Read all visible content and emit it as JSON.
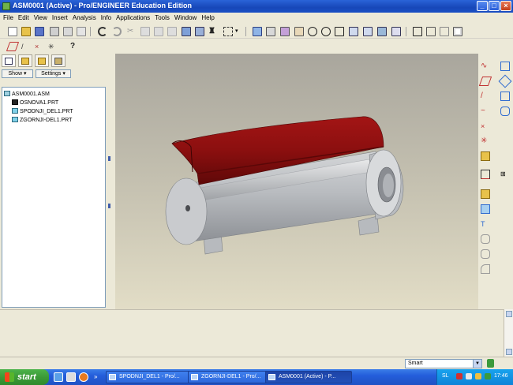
{
  "window": {
    "title": "ASM0001 (Active) - Pro/ENGINEER Education Edition",
    "minimize": "_",
    "maximize": "□",
    "close": "×"
  },
  "menu": [
    "File",
    "Edit",
    "View",
    "Insert",
    "Analysis",
    "Info",
    "Applications",
    "Tools",
    "Window",
    "Help"
  ],
  "left_panel": {
    "show_button": "Show ▾",
    "settings_button": "Settings ▾",
    "tree": [
      {
        "label": "ASM0001.ASM",
        "icon": "assembly-icon"
      },
      {
        "label": "OSNOVA1.PRT",
        "icon": "part-icon"
      },
      {
        "label": "SPODNJI_DEL1.PRT",
        "icon": "part-icon"
      },
      {
        "label": "ZGORNJI-DEL1.PRT",
        "icon": "part-icon"
      }
    ]
  },
  "status": {
    "filter_value": "Smart"
  },
  "taskbar": {
    "start": "start",
    "tasks": [
      {
        "label": "SPODNJI_DEL1 - Pro/...",
        "active": false
      },
      {
        "label": "ZGORNJI-DEL1 - Pro/...",
        "active": false
      },
      {
        "label": "ASM0001 (Active) - P...",
        "active": true
      }
    ],
    "language": "SL",
    "clock": "17:46"
  },
  "colors": {
    "title_bar": "#1747b8",
    "model_red": "#8b0f0f",
    "model_grey": "#b9bcc0",
    "taskbar": "#245edb",
    "start_green": "#3b9a37"
  }
}
